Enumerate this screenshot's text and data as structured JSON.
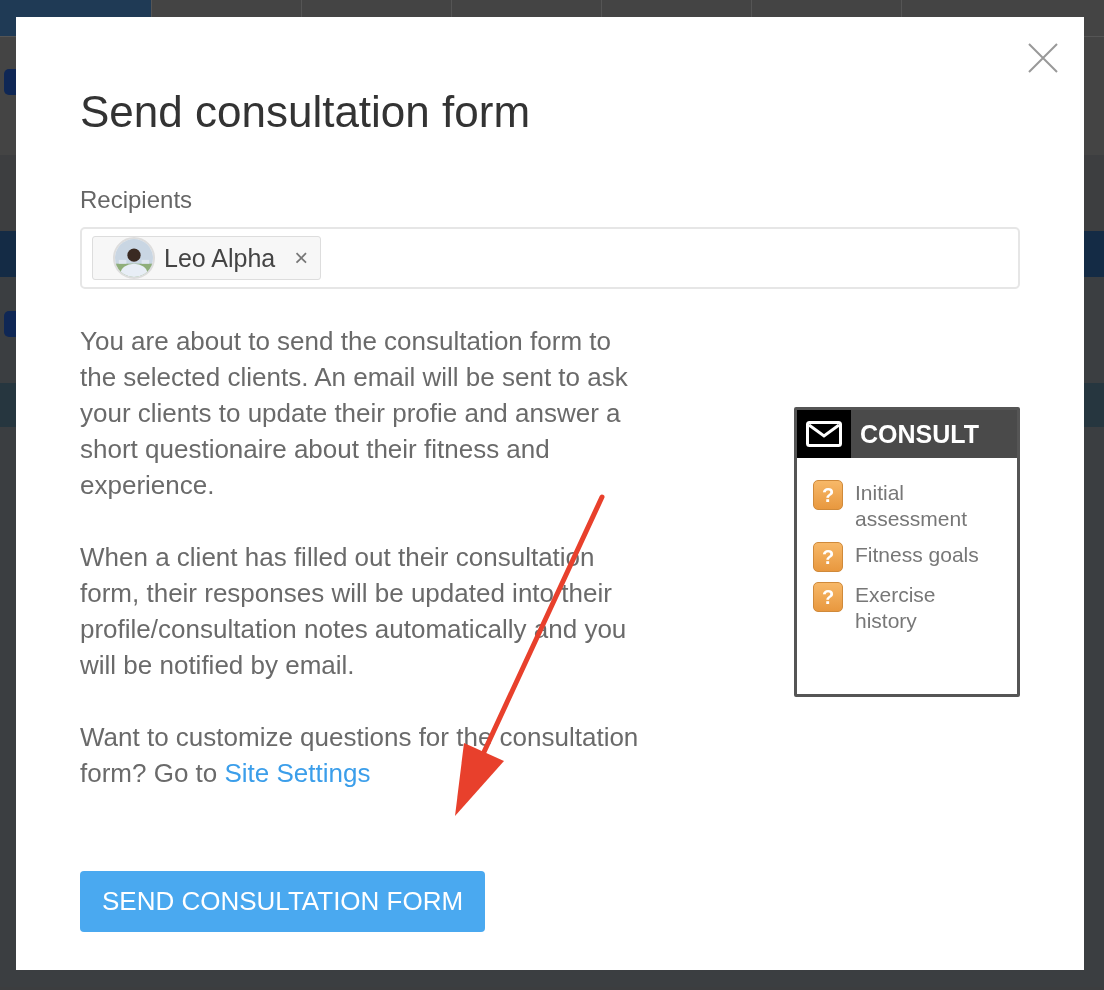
{
  "background": {
    "tabs": [
      {
        "selected": true
      },
      {
        "selected": false
      },
      {
        "selected": false
      },
      {
        "selected": false
      },
      {
        "selected": false
      },
      {
        "selected": false
      }
    ],
    "checkboxes": [
      {
        "checked": true
      },
      {
        "checked": true
      }
    ]
  },
  "dialog": {
    "title": "Send consultation form",
    "recipients": {
      "label": "Recipients",
      "chips": [
        {
          "name": "Leo Alpha",
          "remove": "×"
        }
      ]
    },
    "paragraphs": [
      "You are about to send the consultation form to the selected clients. An email will be sent to ask your clients to update their profie and answer a short questionaire about their fitness and experience.",
      "When a client has filled out their consultation form, their responses will be updated into their profile/consultation notes automatically and you will be notified by email."
    ],
    "customize": {
      "text": "Want to customize questions for the consultation form? Go to",
      "link": "Site Settings"
    },
    "consult_card": {
      "title": "CONSULT",
      "items": [
        {
          "icon": "?",
          "label": "Initial assessment"
        },
        {
          "icon": "?",
          "label": "Fitness goals"
        },
        {
          "icon": "?",
          "label": "Exercise history"
        }
      ]
    },
    "button": "SEND CONSULTATION FORM"
  }
}
